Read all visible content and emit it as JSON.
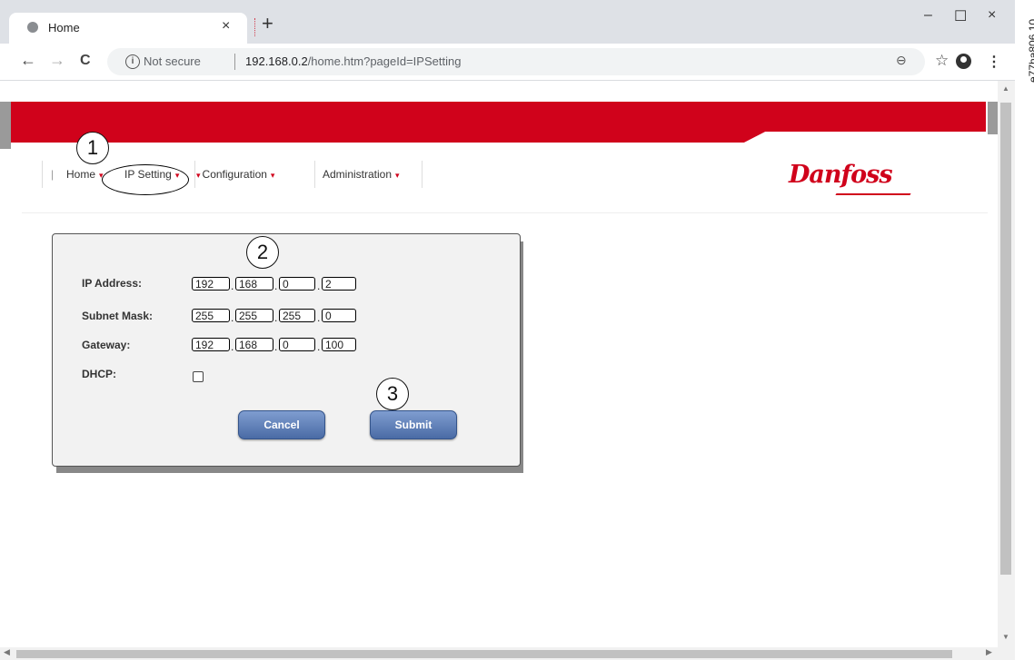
{
  "browser": {
    "tab_title": "Home",
    "tab_close": "×",
    "new_tab": "+",
    "window_buttons": {
      "minimize": "–",
      "maximize": "☐",
      "close": "×"
    },
    "toolbar": {
      "back": "←",
      "forward": "→",
      "reload": "C",
      "star": "☆",
      "menu": "⋮"
    },
    "address": {
      "info_glyph": "i",
      "security_label": "Not secure",
      "host": "192.168.0.2",
      "path": "/home.htm?pageId=IPSetting",
      "zoom_glyph": "⊖"
    }
  },
  "caption": "e77ha806.10",
  "site": {
    "nav": [
      {
        "label": "Home"
      },
      {
        "label": "IP Setting"
      },
      {
        "label": "Configuration"
      },
      {
        "label": "Administration"
      }
    ],
    "nav_pipe": "|",
    "caret": "▾",
    "logo": "Danfoss",
    "brand_color": "#d0021b"
  },
  "form": {
    "ip_address": {
      "label": "IP Address:",
      "octets": [
        "192",
        "168",
        "0",
        "2"
      ]
    },
    "subnet_mask": {
      "label": "Subnet Mask:",
      "octets": [
        "255",
        "255",
        "255",
        "0"
      ]
    },
    "gateway": {
      "label": "Gateway:",
      "octets": [
        "192",
        "168",
        "0",
        "100"
      ]
    },
    "dhcp": {
      "label": "DHCP:",
      "checked": false
    },
    "octet_separator": ".",
    "cancel_label": "Cancel",
    "submit_label": "Submit"
  },
  "callouts": [
    "1",
    "2",
    "3"
  ],
  "scrollbar": {
    "up": "▲",
    "down": "▼",
    "left": "◀",
    "right": "▶"
  }
}
